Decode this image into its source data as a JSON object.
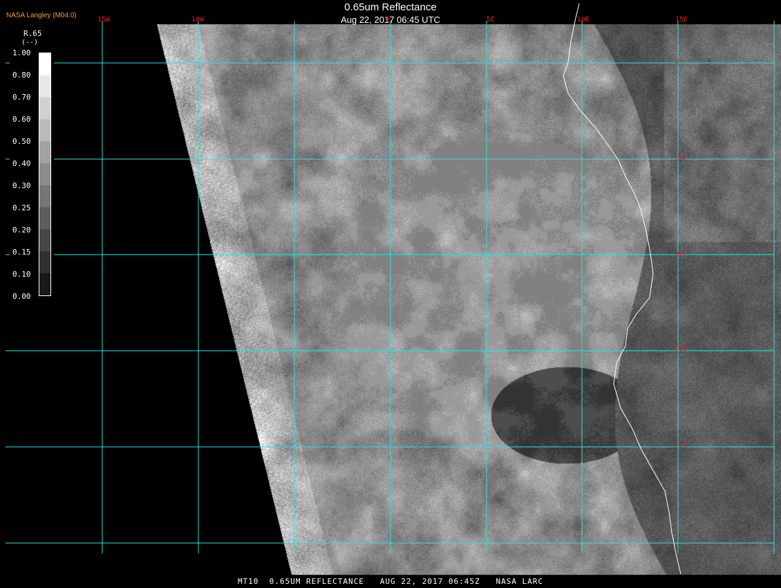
{
  "header": {
    "title": "0.65um Reflectance",
    "datetime": "Aug 22, 2017 06:45 UTC",
    "brand": "NASA Langley (M04.0)"
  },
  "footer": {
    "text": "MT10  0.65UM REFLECTANCE   AUG 22, 2017 06:45Z   NASA LARC"
  },
  "colorbar": {
    "title": "R.65",
    "unit": "(--)",
    "ticks": [
      "1.00",
      "0.80",
      "0.70",
      "0.60",
      "0.50",
      "0.40",
      "0.30",
      "0.25",
      "0.20",
      "0.15",
      "0.10",
      "0.00"
    ]
  },
  "map": {
    "longitude_labels": [
      "15W",
      "10W",
      "0",
      "5E",
      "10E",
      "15E"
    ],
    "latitude_labels": [
      "0",
      "5S",
      "10S",
      "15S",
      "20S"
    ],
    "grid_color": "#30e0e0",
    "label_color": "#e02020"
  }
}
